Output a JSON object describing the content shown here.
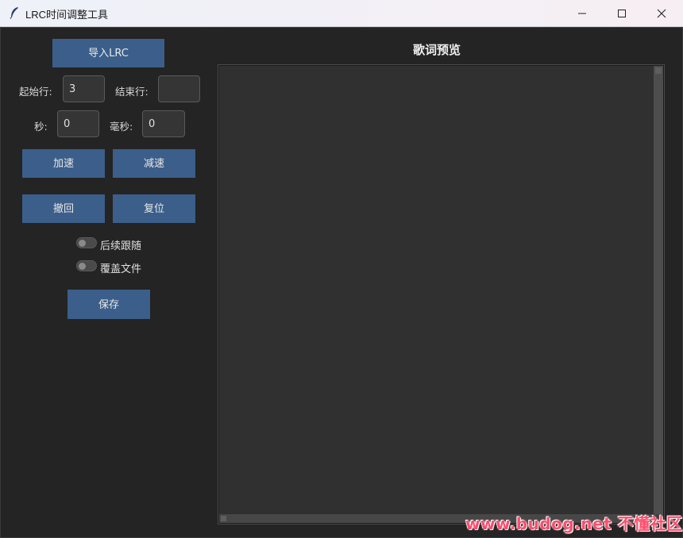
{
  "window": {
    "title": "LRC时间调整工具",
    "controls": {
      "minimize": "minimize",
      "maximize": "maximize",
      "close": "close"
    }
  },
  "left_panel": {
    "import_button": "导入LRC",
    "start_line_label": "起始行:",
    "start_line_value": "3",
    "end_line_label": "结束行:",
    "end_line_value": "",
    "seconds_label": "秒:",
    "seconds_value": "0",
    "milliseconds_label": "毫秒:",
    "milliseconds_value": "0",
    "speed_up_button": "加速",
    "slow_down_button": "减速",
    "undo_button": "撤回",
    "reset_button": "复位",
    "follow_switch_label": "后续跟随",
    "overwrite_switch_label": "覆盖文件",
    "save_button": "保存"
  },
  "preview": {
    "title": "歌词预览",
    "content": ""
  },
  "watermark": "www.budog.net 不懂社区",
  "colors": {
    "button_bg": "#3b5f8a",
    "background": "#242424",
    "preview_bg": "#303030",
    "watermark": "#ff4d6d"
  }
}
